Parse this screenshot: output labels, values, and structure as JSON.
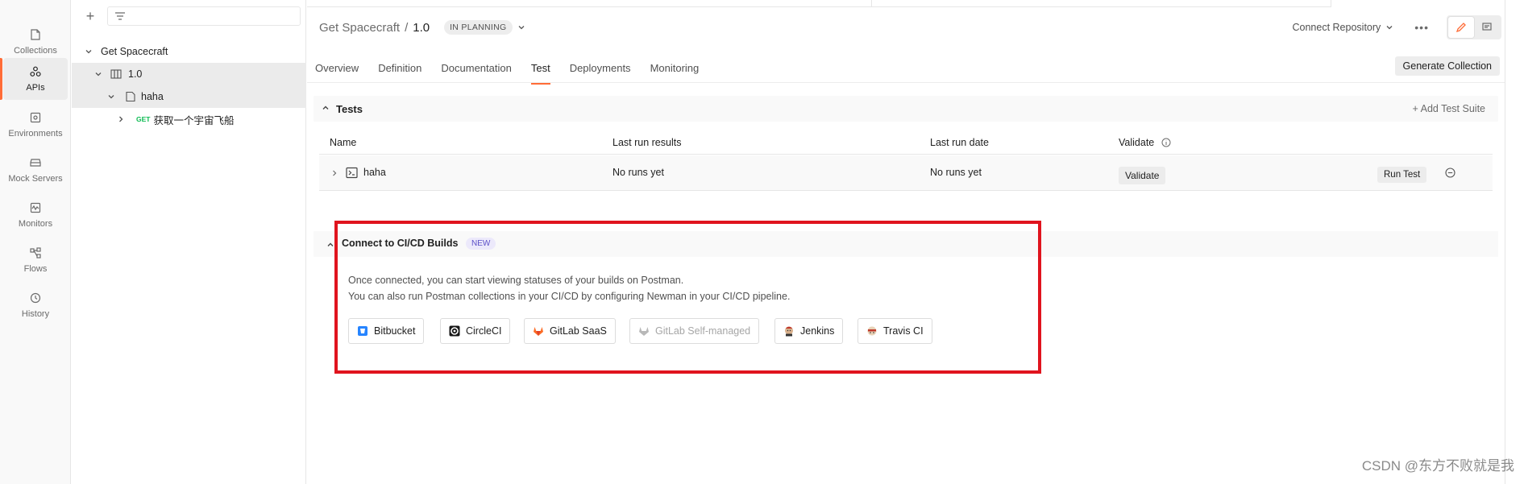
{
  "rail": {
    "items": [
      {
        "label": "Collections",
        "icon": "collections-icon"
      },
      {
        "label": "APIs",
        "icon": "apis-icon",
        "active": true
      },
      {
        "label": "Environments",
        "icon": "environments-icon"
      },
      {
        "label": "Mock Servers",
        "icon": "mock-servers-icon"
      },
      {
        "label": "Monitors",
        "icon": "monitors-icon"
      },
      {
        "label": "Flows",
        "icon": "flows-icon"
      },
      {
        "label": "History",
        "icon": "history-icon"
      }
    ]
  },
  "tree": {
    "api_name": "Get Spacecraft",
    "version": "1.0",
    "folder": "haha",
    "request_method": "GET",
    "request_name": "获取一个宇宙飞船"
  },
  "header": {
    "api_name": "Get Spacecraft",
    "separator": "/",
    "version": "1.0",
    "status": "IN PLANNING",
    "connect_repository": "Connect Repository",
    "more": "•••"
  },
  "tabs": [
    "Overview",
    "Definition",
    "Documentation",
    "Test",
    "Deployments",
    "Monitoring"
  ],
  "active_tab": "Test",
  "generate_collection": "Generate Collection",
  "tests": {
    "section_title": "Tests",
    "add_suite": "+ Add Test Suite",
    "columns": {
      "name": "Name",
      "last_run_results": "Last run results",
      "last_run_date": "Last run date",
      "validate": "Validate"
    },
    "rows": [
      {
        "name": "haha",
        "last_run_results": "No runs yet",
        "last_run_date": "No runs yet",
        "validate_button": "Validate",
        "run_button": "Run Test"
      }
    ]
  },
  "cicd": {
    "title": "Connect to CI/CD Builds",
    "badge": "NEW",
    "line1": "Once connected, you can start viewing statuses of your builds on Postman.",
    "line2": "You can also run Postman collections in your CI/CD by configuring Newman in your CI/CD pipeline.",
    "providers": [
      {
        "label": "Bitbucket",
        "icon": "bitbucket-icon"
      },
      {
        "label": "CircleCI",
        "icon": "circleci-icon"
      },
      {
        "label": "GitLab SaaS",
        "icon": "gitlab-icon"
      },
      {
        "label": "GitLab Self-managed",
        "icon": "gitlab-icon",
        "disabled": true
      },
      {
        "label": "Jenkins",
        "icon": "jenkins-icon"
      },
      {
        "label": "Travis CI",
        "icon": "travis-icon"
      }
    ]
  },
  "colors": {
    "accent": "#ff6c37",
    "highlight": "#e0141e",
    "get": "#0cbb52",
    "badge": "#5b4fc7"
  },
  "watermark": "CSDN @东方不败就是我"
}
